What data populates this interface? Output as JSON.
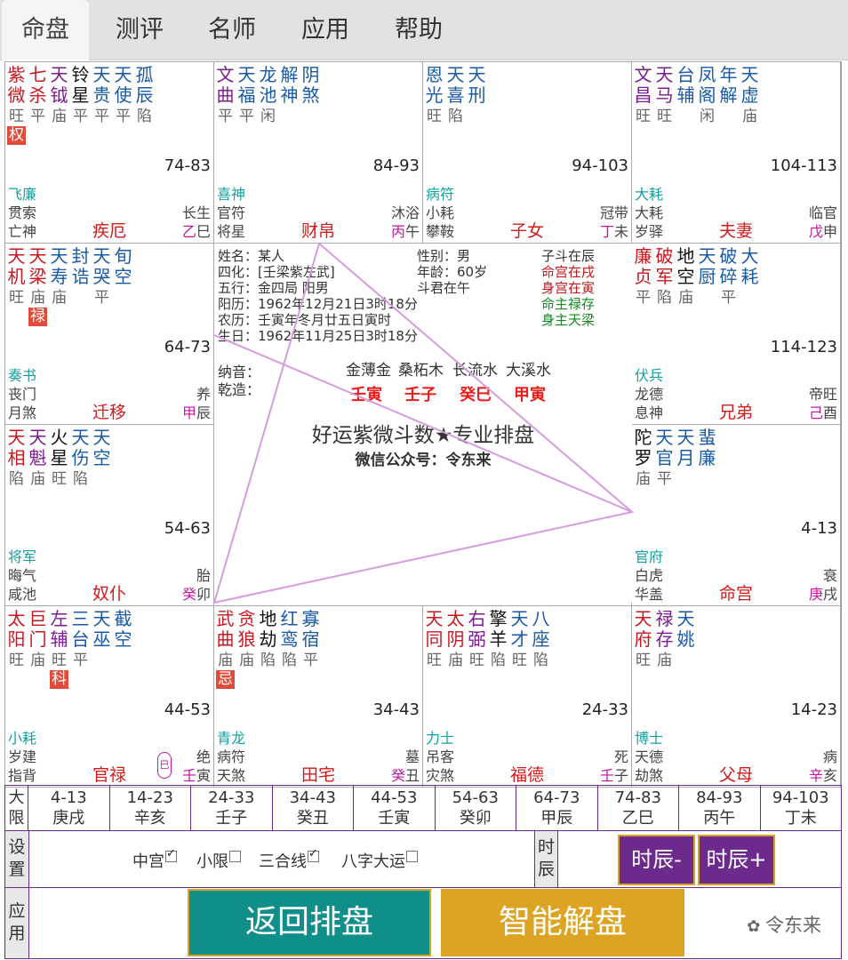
{
  "tabs": [
    "命盘",
    "测评",
    "名师",
    "应用",
    "帮助"
  ],
  "palaces": [
    {
      "stars": [
        {
          "t": "紫\n微",
          "c": "maj",
          "b": "旺",
          "h": "权"
        },
        {
          "t": "七\n杀",
          "c": "maj",
          "b": "平"
        },
        {
          "t": "天\n钺",
          "c": "pur",
          "b": "庙"
        },
        {
          "t": "铃\n星",
          "c": "blk",
          "b": "平"
        },
        {
          "t": "天\n贵",
          "c": "blu",
          "b": "平"
        },
        {
          "t": "天\n使",
          "c": "blu",
          "b": "平"
        },
        {
          "t": "孤\n辰",
          "c": "blu",
          "b": "陷"
        }
      ],
      "range": "74-83",
      "g1": "飞廉",
      "g2": "贯索",
      "g3": "亡神",
      "palace": "疾厄",
      "r2": "长生",
      "r3": "乙巳"
    },
    {
      "stars": [
        {
          "t": "文\n曲",
          "c": "pur",
          "b": "平"
        },
        {
          "t": "天\n福",
          "c": "blu",
          "b": "平"
        },
        {
          "t": "龙\n池",
          "c": "blu",
          "b": "闲"
        },
        {
          "t": "解\n神",
          "c": "blu",
          "b": ""
        },
        {
          "t": "阴\n煞",
          "c": "blu",
          "b": ""
        }
      ],
      "range": "84-93",
      "g1": "喜神",
      "g2": "官符",
      "g3": "将星",
      "palace": "财帛",
      "r2": "沐浴",
      "r3": "丙午"
    },
    {
      "stars": [
        {
          "t": "恩\n光",
          "c": "blu",
          "b": "旺"
        },
        {
          "t": "天\n喜",
          "c": "blu",
          "b": "陷"
        },
        {
          "t": "天\n刑",
          "c": "blu",
          "b": ""
        }
      ],
      "range": "94-103",
      "g1": "病符",
      "g2": "小耗",
      "g3": "攀鞍",
      "palace": "子女",
      "r2": "冠带",
      "r3": "丁未"
    },
    {
      "stars": [
        {
          "t": "文\n昌",
          "c": "pur",
          "b": "旺"
        },
        {
          "t": "天\n马",
          "c": "pur",
          "b": "旺"
        },
        {
          "t": "台\n辅",
          "c": "blu",
          "b": ""
        },
        {
          "t": "凤\n阁",
          "c": "blu",
          "b": "闲"
        },
        {
          "t": "年\n解",
          "c": "blu",
          "b": ""
        },
        {
          "t": "天\n虚",
          "c": "blu",
          "b": "庙"
        }
      ],
      "range": "104-113",
      "g1": "大耗",
      "g2": "大耗",
      "g3": "岁驿",
      "palace": "夫妻",
      "r2": "临官",
      "r3": "戊申"
    },
    {
      "stars": [
        {
          "t": "廉\n贞",
          "c": "maj",
          "b": "平"
        },
        {
          "t": "破\n军",
          "c": "maj",
          "b": "陷"
        },
        {
          "t": "地\n空",
          "c": "blk",
          "b": "庙"
        },
        {
          "t": "天\n厨",
          "c": "blu",
          "b": ""
        },
        {
          "t": "破\n碎",
          "c": "blu",
          "b": "平"
        },
        {
          "t": "大\n耗",
          "c": "blu",
          "b": ""
        }
      ],
      "range": "114-123",
      "g1": "伏兵",
      "g2": "龙德",
      "g3": "息神",
      "palace": "兄弟",
      "r2": "帝旺",
      "r3": "己酉"
    },
    {
      "stars": [
        {
          "t": "陀\n罗",
          "c": "blk",
          "b": "庙"
        },
        {
          "t": "天\n官",
          "c": "blu",
          "b": "平"
        },
        {
          "t": "天\n月",
          "c": "blu",
          "b": ""
        },
        {
          "t": "蜚\n廉",
          "c": "blu",
          "b": ""
        }
      ],
      "range": "4-13",
      "g1": "官府",
      "g2": "白虎",
      "g3": "华盖",
      "palace": "命宫",
      "r2": "衰",
      "r3": "庚戌"
    },
    {
      "stars": [
        {
          "t": "天\n府",
          "c": "maj",
          "b": "旺"
        },
        {
          "t": "禄\n存",
          "c": "pur",
          "b": "庙"
        },
        {
          "t": "天\n姚",
          "c": "blu",
          "b": ""
        }
      ],
      "range": "14-23",
      "g1": "博士",
      "g2": "天德",
      "g3": "劫煞",
      "palace": "父母",
      "r2": "病",
      "r3": "辛亥"
    },
    {
      "stars": [
        {
          "t": "天\n同",
          "c": "maj",
          "b": "旺"
        },
        {
          "t": "太\n阴",
          "c": "maj",
          "b": "庙"
        },
        {
          "t": "右\n弼",
          "c": "pur",
          "b": "旺"
        },
        {
          "t": "擎\n羊",
          "c": "blk",
          "b": "陷"
        },
        {
          "t": "天\n才",
          "c": "blu",
          "b": "旺"
        },
        {
          "t": "八\n座",
          "c": "blu",
          "b": "陷"
        }
      ],
      "range": "24-33",
      "g1": "力士",
      "g2": "吊客",
      "g3": "灾煞",
      "palace": "福德",
      "r2": "死",
      "r3": "壬子"
    },
    {
      "stars": [
        {
          "t": "武\n曲",
          "c": "maj",
          "b": "庙",
          "h": "忌"
        },
        {
          "t": "贪\n狼",
          "c": "maj",
          "b": "庙"
        },
        {
          "t": "地\n劫",
          "c": "blk",
          "b": "陷"
        },
        {
          "t": "红\n鸾",
          "c": "blu",
          "b": "陷"
        },
        {
          "t": "寡\n宿",
          "c": "blu",
          "b": "平"
        }
      ],
      "range": "34-43",
      "g1": "青龙",
      "g2": "病符",
      "g3": "天煞",
      "palace": "田宅",
      "r2": "墓",
      "r3": "癸丑"
    },
    {
      "stars": [
        {
          "t": "太\n阳",
          "c": "maj",
          "b": "旺"
        },
        {
          "t": "巨\n门",
          "c": "maj",
          "b": "庙"
        },
        {
          "t": "左\n辅",
          "c": "pur",
          "b": "旺",
          "h": "科"
        },
        {
          "t": "三\n台",
          "c": "blu",
          "b": "平"
        },
        {
          "t": "天\n巫",
          "c": "blu",
          "b": ""
        },
        {
          "t": "截\n空",
          "c": "blu",
          "b": ""
        }
      ],
      "range": "44-53",
      "g1": "小耗",
      "g2": "岁建",
      "g3": "指背",
      "palace": "官禄",
      "r2": "绝",
      "r3": "壬寅"
    },
    {
      "stars": [
        {
          "t": "天\n相",
          "c": "maj",
          "b": "陷"
        },
        {
          "t": "天\n魁",
          "c": "pur",
          "b": "庙"
        },
        {
          "t": "火\n星",
          "c": "blk",
          "b": "旺"
        },
        {
          "t": "天\n伤",
          "c": "blu",
          "b": "陷"
        },
        {
          "t": "天\n空",
          "c": "blu",
          "b": ""
        }
      ],
      "range": "54-63",
      "g1": "将军",
      "g2": "晦气",
      "g3": "咸池",
      "palace": "奴仆",
      "r2": "胎",
      "r3": "癸卯"
    },
    {
      "stars": [
        {
          "t": "天\n机",
          "c": "maj",
          "b": "旺"
        },
        {
          "t": "天\n梁",
          "c": "maj",
          "b": "庙",
          "h": "禄"
        },
        {
          "t": "天\n寿",
          "c": "blu",
          "b": "庙"
        },
        {
          "t": "封\n诰",
          "c": "blu",
          "b": ""
        },
        {
          "t": "天\n哭",
          "c": "blu",
          "b": "平"
        },
        {
          "t": "旬\n空",
          "c": "blu",
          "b": ""
        }
      ],
      "range": "64-73",
      "g1": "奏书",
      "g2": "丧门",
      "g3": "月煞",
      "palace": "迁移",
      "r2": "养",
      "r3": "甲辰"
    }
  ],
  "center": {
    "name": "姓名：某人",
    "sihua": "四化：[壬梁紫左武]",
    "wuxing": "五行：金四局 阳男",
    "yangli": "阳历：1962年12月21日3时18分",
    "nongli": "农历：壬寅年冬月廿五日寅时",
    "shengri": "生日：1962年11月25日3时18分",
    "gender": "性别：男",
    "age": "年龄：60岁",
    "doujun": "斗君在午",
    "r1": "子斗在辰",
    "r2": "命宫在戌",
    "r3": "身宫在寅",
    "r4": "命主禄存",
    "r5": "身主天梁",
    "nayin_label": "纳音：",
    "qianzao_label": "乾造：",
    "nayin": [
      "金薄金",
      "桑柘木",
      "长流水",
      "大溪水"
    ],
    "bazi": [
      "壬寅",
      "壬子",
      "癸巳",
      "甲寅"
    ],
    "title": "好运紫微斗数★专业排盘",
    "subtitle": "微信公众号：令东来"
  },
  "side_note": "巳",
  "limits_header": "大\n限",
  "limits": [
    [
      "4-13",
      "庚戌"
    ],
    [
      "14-23",
      "辛亥"
    ],
    [
      "24-33",
      "壬子"
    ],
    [
      "34-43",
      "癸丑"
    ],
    [
      "44-53",
      "壬寅"
    ],
    [
      "54-63",
      "癸卯"
    ],
    [
      "64-73",
      "甲辰"
    ],
    [
      "74-83",
      "乙巳"
    ],
    [
      "84-93",
      "丙午"
    ],
    [
      "94-103",
      "丁未"
    ]
  ],
  "settings": {
    "label": "设\n置",
    "zhonggong": "中宫",
    "xiaoxian": "小限",
    "sanhe": "三合线",
    "bazi": "八字大运",
    "shichen_label": "时\n辰",
    "prev": "时辰-",
    "next": "时辰+"
  },
  "apps": {
    "label": "应\n用",
    "back": "返回排盘",
    "smart": "智能解盘",
    "watermark": "令东来"
  }
}
